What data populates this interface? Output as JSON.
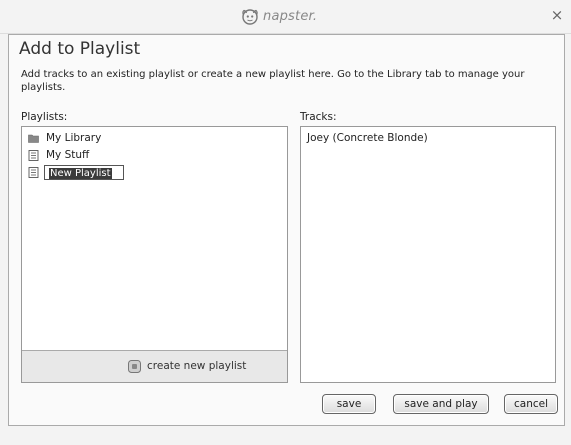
{
  "titlebar": {
    "brand": "napster.",
    "close": "×"
  },
  "dialog": {
    "title": "Add to Playlist",
    "description": "Add tracks to an existing playlist or create a new playlist here. Go to the Library tab to manage your playlists."
  },
  "playlists": {
    "label": "Playlists:",
    "items": [
      {
        "label": "My Library",
        "icon": "folder-icon"
      },
      {
        "label": "My Stuff",
        "icon": "playlist-icon"
      }
    ],
    "new_item_value": "New Playlist",
    "create_label": "create new playlist"
  },
  "tracks": {
    "label": "Tracks:",
    "items": [
      "Joey (Concrete Blonde)"
    ]
  },
  "buttons": {
    "save": "save",
    "save_and_play": "save and play",
    "cancel": "cancel"
  }
}
